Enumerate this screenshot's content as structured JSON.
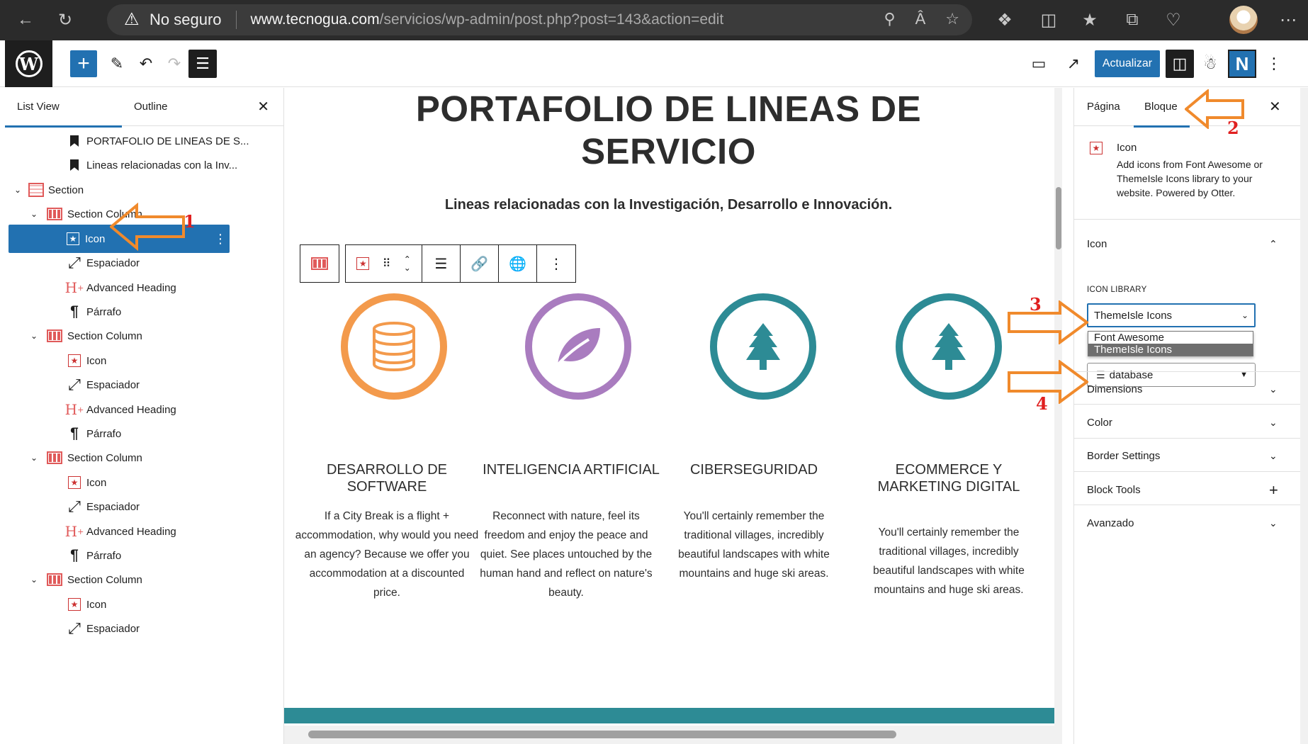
{
  "browser": {
    "security_label": "No seguro",
    "url_host": "www.tecnogua.com",
    "url_path": "/servicios/wp-admin/post.php?post=143&action=edit"
  },
  "toolbar": {
    "update_label": "Actualizar",
    "plugin_badge": "N"
  },
  "list_view": {
    "tabs": [
      "List View",
      "Outline"
    ],
    "items": [
      {
        "label": "PORTAFOLIO DE LINEAS DE S...",
        "icon": "bookmark-icon"
      },
      {
        "label": "Lineas relacionadas con la Inv...",
        "icon": "bookmark-icon"
      },
      {
        "label": "Section",
        "icon": "section-icon"
      },
      {
        "label": "Section Column",
        "icon": "columns-icon"
      },
      {
        "label": "Icon",
        "icon": "star-icon"
      },
      {
        "label": "Espaciador",
        "icon": "resize-icon"
      },
      {
        "label": "Advanced Heading",
        "icon": "heading-icon"
      },
      {
        "label": "Párrafo",
        "icon": "paragraph-icon"
      },
      {
        "label": "Section Column",
        "icon": "columns-icon"
      },
      {
        "label": "Icon",
        "icon": "star-icon"
      },
      {
        "label": "Espaciador",
        "icon": "resize-icon"
      },
      {
        "label": "Advanced Heading",
        "icon": "heading-icon"
      },
      {
        "label": "Párrafo",
        "icon": "paragraph-icon"
      },
      {
        "label": "Section Column",
        "icon": "columns-icon"
      },
      {
        "label": "Icon",
        "icon": "star-icon"
      },
      {
        "label": "Espaciador",
        "icon": "resize-icon"
      },
      {
        "label": "Advanced Heading",
        "icon": "heading-icon"
      },
      {
        "label": "Párrafo",
        "icon": "paragraph-icon"
      },
      {
        "label": "Section Column",
        "icon": "columns-icon"
      },
      {
        "label": "Icon",
        "icon": "star-icon"
      },
      {
        "label": "Espaciador",
        "icon": "resize-icon"
      }
    ]
  },
  "canvas": {
    "title_line1": "PORTAFOLIO DE LINEAS DE",
    "title_line2": "SERVICIO",
    "subtitle": "Lineas relacionadas con la Investigación, Desarrollo e Innovación.",
    "cards": [
      {
        "title": "DESARROLLO DE SOFTWARE",
        "text": "If a City Break is a flight + accommodation, why would you need an agency? Because we offer you accommodation at a discounted price.",
        "color": "#f39a4c",
        "icon": "database-icon"
      },
      {
        "title": "INTELIGENCIA ARTIFICIAL",
        "text": "Reconnect with nature, feel its freedom and enjoy the peace and quiet. See places untouched by the human hand and reflect on nature's beauty.",
        "color": "#a97cbf",
        "icon": "leaf-icon"
      },
      {
        "title": "CIBERSEGURIDAD",
        "text": "You'll certainly remember the traditional villages, incredibly beautiful landscapes with white mountains and huge ski areas.",
        "color": "#2d8b95",
        "icon": "tree-icon"
      },
      {
        "title": "ECOMMERCE Y MARKETING DIGITAL",
        "text": "You'll certainly remember the traditional villages, incredibly beautiful landscapes with white mountains and huge ski areas.",
        "color": "#2d8b95",
        "icon": "tree-icon"
      }
    ]
  },
  "sidebar": {
    "tabs": [
      "Página",
      "Bloque"
    ],
    "block_name": "Icon",
    "block_desc": "Add icons from Font Awesome or ThemeIsle Icons library to your website. Powered by Otter.",
    "icon_panel": "Icon",
    "library_label": "ICON LIBRARY",
    "library_value": "ThemeIsle Icons",
    "library_options": [
      "Font Awesome",
      "ThemeIsle Icons"
    ],
    "selected_icon": "database",
    "panels": [
      "Dimensions",
      "Color",
      "Border Settings",
      "Block Tools",
      "Avanzado"
    ]
  },
  "annotations": [
    "1",
    "2",
    "3",
    "4"
  ],
  "colors": {
    "accent": "#2271b1",
    "annotation_arrow": "#f08a2c",
    "annotation_number": "#e02020"
  }
}
